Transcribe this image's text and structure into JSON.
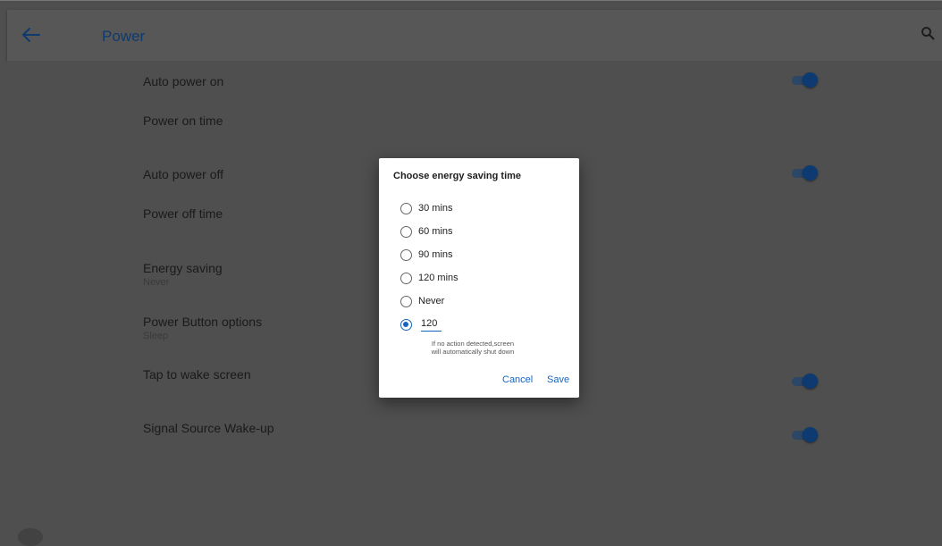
{
  "appbar": {
    "title": "Power",
    "back_icon": "arrow-left-icon",
    "search_icon": "search-icon",
    "title_color": "#0f3a6e"
  },
  "settings": {
    "auto_power_on": {
      "label": "Auto power on",
      "toggle": true
    },
    "power_on_time": {
      "label": "Power on time"
    },
    "auto_power_off": {
      "label": "Auto power off",
      "toggle": true
    },
    "power_off_time": {
      "label": "Power off time"
    },
    "energy_saving": {
      "label": "Energy saving",
      "value": "Never"
    },
    "power_button_options": {
      "label": "Power Button options",
      "value": "Sleep"
    },
    "tap_to_wake": {
      "label": "Tap to wake screen",
      "toggle": true
    },
    "signal_source_wakeup": {
      "label": "Signal Source Wake-up",
      "toggle": true
    }
  },
  "dialog": {
    "title": "Choose energy saving time",
    "options": [
      {
        "label": "30 mins",
        "checked": false
      },
      {
        "label": "60 mins",
        "checked": false
      },
      {
        "label": "90 mins",
        "checked": false
      },
      {
        "label": "120 mins",
        "checked": false
      },
      {
        "label": "Never",
        "checked": false
      }
    ],
    "custom_option": {
      "value": "120",
      "checked": true
    },
    "hint_line1": "If no action detected,screen",
    "hint_line2": "will automatically shut down",
    "cancel_label": "Cancel",
    "save_label": "Save",
    "accent_color": "#1565c0"
  }
}
